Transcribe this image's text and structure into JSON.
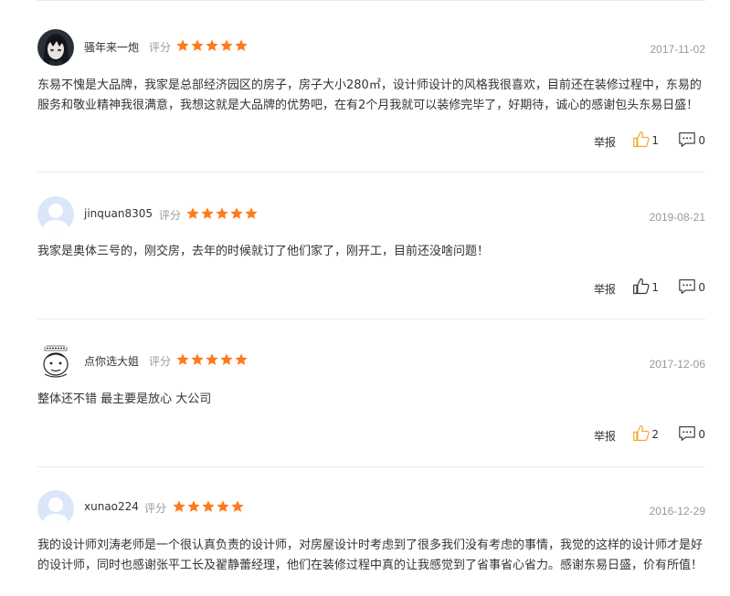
{
  "rating_label": "评分",
  "report_label": "举报",
  "colors": {
    "star": "#ff7a1a",
    "like_icon": "#f5a623",
    "text": "#333333",
    "muted": "#999999",
    "divider": "#ebebeb"
  },
  "reviews": [
    {
      "username": "骚年来一炮",
      "avatar": "anime-portrait",
      "stars": 5,
      "date": "2017-11-02",
      "content": "东易不愧是大品牌，我家是总部经济园区的房子，房子大小280㎡，设计师设计的风格我很喜欢，目前还在装修过程中，东易的服务和敬业精神我很满意，我想这就是大品牌的优势吧，在有2个月我就可以装修完毕了，好期待，诚心的感谢包头东易日盛！",
      "likes": "1",
      "comments": "0"
    },
    {
      "username": "jinquan8305",
      "avatar": "default-user",
      "stars": 5,
      "date": "2019-08-21",
      "content": "我家是奥体三号的，刚交房，去年的时候就订了他们家了，刚开工，目前还没啥问题！",
      "likes": "1",
      "comments": "0"
    },
    {
      "username": "点你选大姐",
      "avatar": "cartoon-sketch",
      "stars": 5,
      "date": "2017-12-06",
      "content": "整体还不错 最主要是放心 大公司",
      "likes": "2",
      "comments": "0"
    },
    {
      "username": "xunao224",
      "avatar": "default-user",
      "stars": 5,
      "date": "2016-12-29",
      "content": "我的设计师刘涛老师是一个很认真负责的设计师，对房屋设计时考虑到了很多我们没有考虑的事情，我觉的这样的设计师才是好的设计师，同时也感谢张平工长及翟静蕾经理，他们在装修过程中真的让我感觉到了省事省心省力。感谢东易日盛，价有所值！",
      "likes": "",
      "comments": ""
    }
  ]
}
